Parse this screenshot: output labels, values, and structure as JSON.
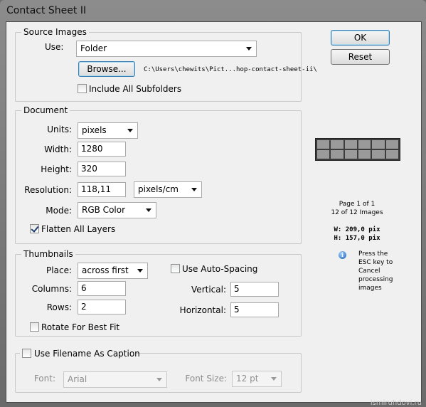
{
  "window": {
    "title": "Contact Sheet II"
  },
  "buttons": {
    "ok": "OK",
    "reset": "Reset"
  },
  "source_images": {
    "legend": "Source Images",
    "use_label": "Use:",
    "use_value": "Folder",
    "browse_label": "Browse...",
    "path": "C:\\Users\\chewits\\Pict...hop-contact-sheet-ii\\",
    "include_subfolders_label": "Include All Subfolders",
    "include_subfolders_checked": false
  },
  "document": {
    "legend": "Document",
    "units_label": "Units:",
    "units_value": "pixels",
    "width_label": "Width:",
    "width_value": "1280",
    "height_label": "Height:",
    "height_value": "320",
    "resolution_label": "Resolution:",
    "resolution_value": "118,11",
    "resolution_unit": "pixels/cm",
    "mode_label": "Mode:",
    "mode_value": "RGB Color",
    "flatten_label": "Flatten All Layers",
    "flatten_checked": true
  },
  "thumbnails": {
    "legend": "Thumbnails",
    "place_label": "Place:",
    "place_value": "across first",
    "columns_label": "Columns:",
    "columns_value": "6",
    "rows_label": "Rows:",
    "rows_value": "2",
    "rotate_label": "Rotate For Best Fit",
    "rotate_checked": false,
    "auto_spacing_label": "Use Auto-Spacing",
    "auto_spacing_checked": false,
    "vertical_label": "Vertical:",
    "vertical_value": "5",
    "horizontal_label": "Horizontal:",
    "horizontal_value": "5"
  },
  "caption": {
    "use_filename_label": "Use Filename As Caption",
    "use_filename_checked": false,
    "font_label": "Font:",
    "font_value": "Arial",
    "font_size_label": "Font Size:",
    "font_size_value": "12 pt"
  },
  "preview": {
    "columns": 6,
    "rows": 2,
    "page_info": "Page 1 of 1",
    "images_info": "12 of 12 Images",
    "width_info": "W: 209,0 pix",
    "height_info": "H: 157,0 pix",
    "info_icon": "info-icon",
    "hint": [
      "Press the",
      "ESC key to",
      "Cancel",
      "processing",
      "images"
    ]
  },
  "watermark": "ismiruhdovi.ru"
}
